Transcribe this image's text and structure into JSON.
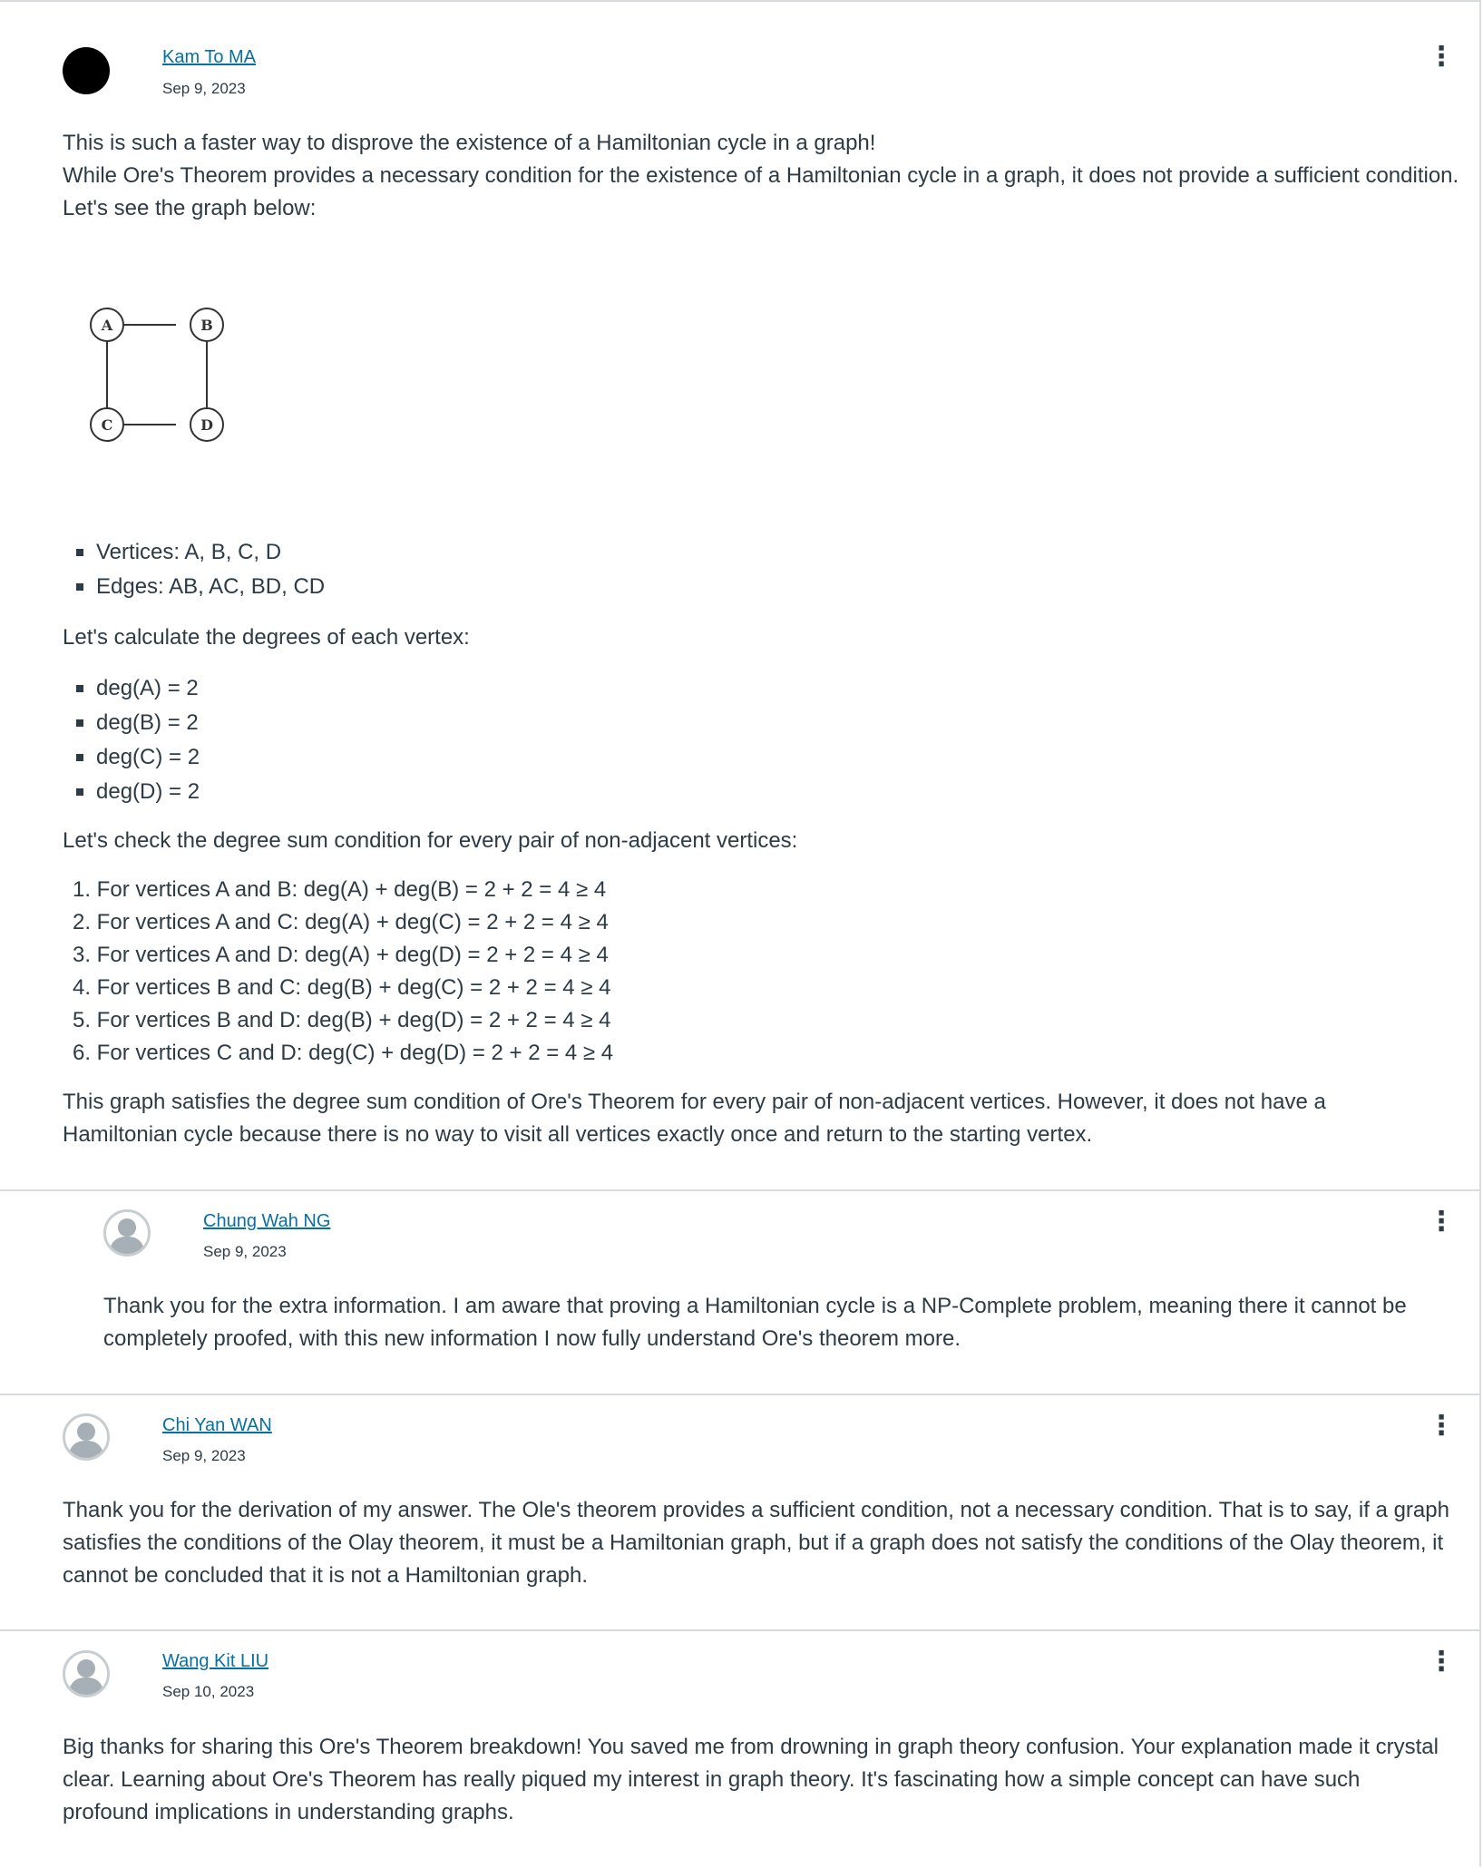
{
  "posts": [
    {
      "author": "Kam To MA",
      "date": "Sep 9, 2023",
      "intro": [
        "This is such a faster way to disprove the existence of a Hamiltonian cycle in a graph!",
        "While Ore's Theorem provides a necessary condition for the existence of a Hamiltonian cycle in a graph, it does not provide a sufficient condition.",
        "Let's see the graph below:"
      ],
      "graph": {
        "nodes": [
          "A",
          "B",
          "C",
          "D"
        ]
      },
      "graph_facts": [
        "Vertices: A, B, C, D",
        "Edges: AB, AC, BD, CD"
      ],
      "degrees_heading": "Let's calculate the degrees of each vertex:",
      "degrees": [
        "deg(A) = 2",
        "deg(B) = 2",
        "deg(C) = 2",
        "deg(D) = 2"
      ],
      "check_heading": "Let's check the degree sum condition for every pair of non-adjacent vertices:",
      "checks": [
        "1. For vertices A and B: deg(A) + deg(B) = 2 + 2 = 4 ≥ 4",
        "2. For vertices A and C: deg(A) + deg(C) = 2 + 2 = 4 ≥ 4",
        "3. For vertices A and D: deg(A) + deg(D) = 2 + 2 = 4 ≥ 4",
        "4. For vertices B and C: deg(B) + deg(C) = 2 + 2 = 4 ≥ 4",
        "5. For vertices B and D: deg(B) + deg(D) = 2 + 2 = 4 ≥ 4",
        "6. For vertices C and D: deg(C) + deg(D) = 2 + 2 = 4 ≥ 4"
      ],
      "conclusion": "This graph satisfies the degree sum condition of Ore's Theorem for every pair of non-adjacent vertices. However, it does not have a Hamiltonian cycle because there is no way to visit all vertices exactly once and return to the starting vertex."
    },
    {
      "author": "Chung Wah NG",
      "date": "Sep 9, 2023",
      "text": "Thank you for the extra information. I am aware that proving a Hamiltonian cycle is a NP-Complete problem, meaning there it cannot be completely proofed, with this new information I now fully understand Ore's theorem more."
    },
    {
      "author": "Chi Yan WAN",
      "date": "Sep 9, 2023",
      "text": "Thank you for the derivation of my answer. The Ole's theorem provides a sufficient condition, not a necessary condition. That is to say, if a graph satisfies the conditions of the Olay theorem, it must be a Hamiltonian graph, but if a graph does not satisfy the conditions of the Olay theorem, it cannot be concluded that it is not a Hamiltonian graph."
    },
    {
      "author": "Wang Kit LIU",
      "date": "Sep 10, 2023",
      "text": "Big thanks for sharing this Ore's Theorem breakdown! You saved me from drowning in graph theory confusion. Your explanation made it crystal clear. Learning about Ore's Theorem has really piqued my interest in graph theory. It's fascinating how a simple concept can have such profound implications in understanding graphs."
    }
  ],
  "icons": {
    "more": "kebab-vertical-icon",
    "avatar_default": "user-silhouette-icon"
  },
  "colors": {
    "link": "#0770a3",
    "text": "#2d3b45",
    "divider": "#d7dbde"
  }
}
